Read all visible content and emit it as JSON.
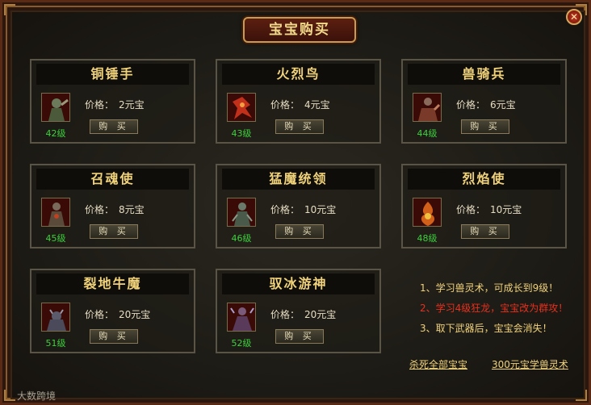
{
  "window": {
    "title": "宝宝购买",
    "close_label": "✕"
  },
  "price_label": "价格：",
  "buy_label": "购 买",
  "pets": [
    {
      "name": "铜锤手",
      "price": "2元宝",
      "level": "42级",
      "color": "#6a7a5a"
    },
    {
      "name": "火烈鸟",
      "price": "4元宝",
      "level": "43级",
      "color": "#c0301a"
    },
    {
      "name": "兽骑兵",
      "price": "6元宝",
      "level": "44级",
      "color": "#7a3a2a"
    },
    {
      "name": "召魂使",
      "price": "8元宝",
      "level": "45级",
      "color": "#5a4a3a"
    },
    {
      "name": "猛魔统领",
      "price": "10元宝",
      "level": "46级",
      "color": "#4a5a4a"
    },
    {
      "name": "烈焰使",
      "price": "10元宝",
      "level": "48级",
      "color": "#d0601a"
    },
    {
      "name": "裂地牛魔",
      "price": "20元宝",
      "level": "51级",
      "color": "#4a4a5a"
    },
    {
      "name": "驭冰游神",
      "price": "20元宝",
      "level": "52级",
      "color": "#5a3a5a"
    }
  ],
  "tips": [
    {
      "text": "1、学习兽灵术，可成长到9级！",
      "color": "#f0d27a"
    },
    {
      "text": "2、学习4级狂龙，宝宝改为群攻！",
      "color": "#e8301e"
    },
    {
      "text": "3、取下武器后，宝宝会消失！",
      "color": "#f0d27a"
    }
  ],
  "links": {
    "kill_all": "杀死全部宝宝",
    "learn": "300元宝学兽灵术"
  },
  "watermark": "大数跨境"
}
